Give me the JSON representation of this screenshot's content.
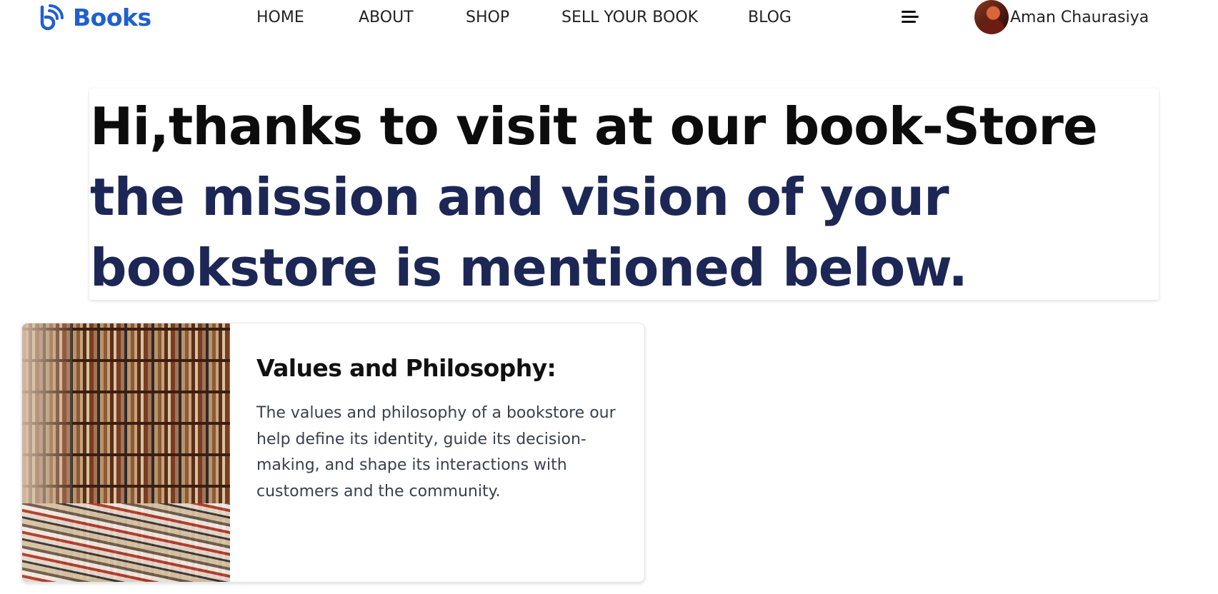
{
  "brand": {
    "logo_icon": "rss-b-logo-icon",
    "name": "Books",
    "color": "#1f5fd1"
  },
  "nav": {
    "items": [
      {
        "label": "HOME"
      },
      {
        "label": "ABOUT"
      },
      {
        "label": "SHOP"
      },
      {
        "label": "SELL YOUR BOOK"
      },
      {
        "label": "BLOG"
      }
    ],
    "menu_icon": "hamburger-menu-icon"
  },
  "user": {
    "name": "Aman Chaurasiya",
    "avatar_icon": "user-avatar"
  },
  "hero": {
    "lead": "Hi,thanks to visit at our book-Store ",
    "accent": "the mission and vision of your bookstore is mentioned below.",
    "accent_color": "#1c2755"
  },
  "card": {
    "image": "bookstore-shelves-photo",
    "title": "Values and Philosophy:",
    "description": "The values and philosophy of a bookstore our help define its identity, guide its decision-making, and shape its interactions with customers and the community."
  }
}
